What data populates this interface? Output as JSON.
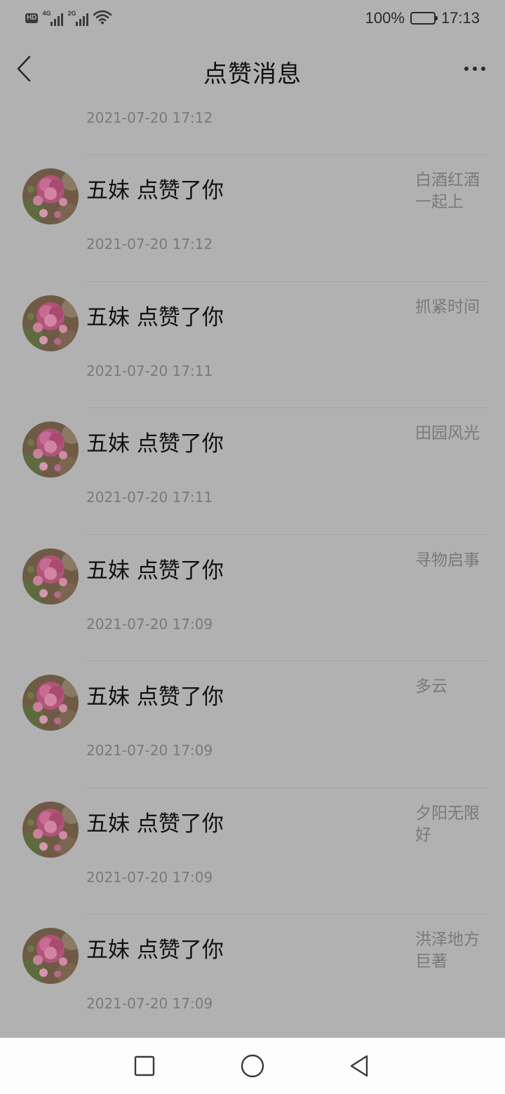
{
  "status_bar": {
    "hd": "HD",
    "sim1_network": "4G",
    "sim2_network": "2G",
    "battery": "100%",
    "time": "17:13"
  },
  "header": {
    "title": "点赞消息"
  },
  "top_item_time": "2021-07-20 17:12",
  "items": [
    {
      "liker": "五妹 点赞了你",
      "post": "白酒红酒一起上",
      "time": "2021-07-20 17:12"
    },
    {
      "liker": "五妹 点赞了你",
      "post": "抓紧时间",
      "time": "2021-07-20 17:11"
    },
    {
      "liker": "五妹 点赞了你",
      "post": "田园风光",
      "time": "2021-07-20 17:11"
    },
    {
      "liker": "五妹 点赞了你",
      "post": "寻物启事",
      "time": "2021-07-20 17:09"
    },
    {
      "liker": "五妹 点赞了你",
      "post": "多云",
      "time": "2021-07-20 17:09"
    },
    {
      "liker": "五妹 点赞了你",
      "post": "夕阳无限好",
      "time": "2021-07-20 17:09"
    },
    {
      "liker": "五妹 点赞了你",
      "post": "洪泽地方巨著",
      "time": "2021-07-20 17:09"
    }
  ],
  "icons": {
    "back": "chevron-left-icon",
    "more": "more-dots-icon",
    "avatar": "flower-avatar",
    "nav_recents": "square-icon",
    "nav_home": "circle-icon",
    "nav_back": "triangle-back-icon"
  },
  "colors": {
    "background": "#b1b1b1",
    "secondary_text": "#7a7a7a",
    "primary_text": "#111111",
    "nav_bar": "#fdfdfd"
  }
}
